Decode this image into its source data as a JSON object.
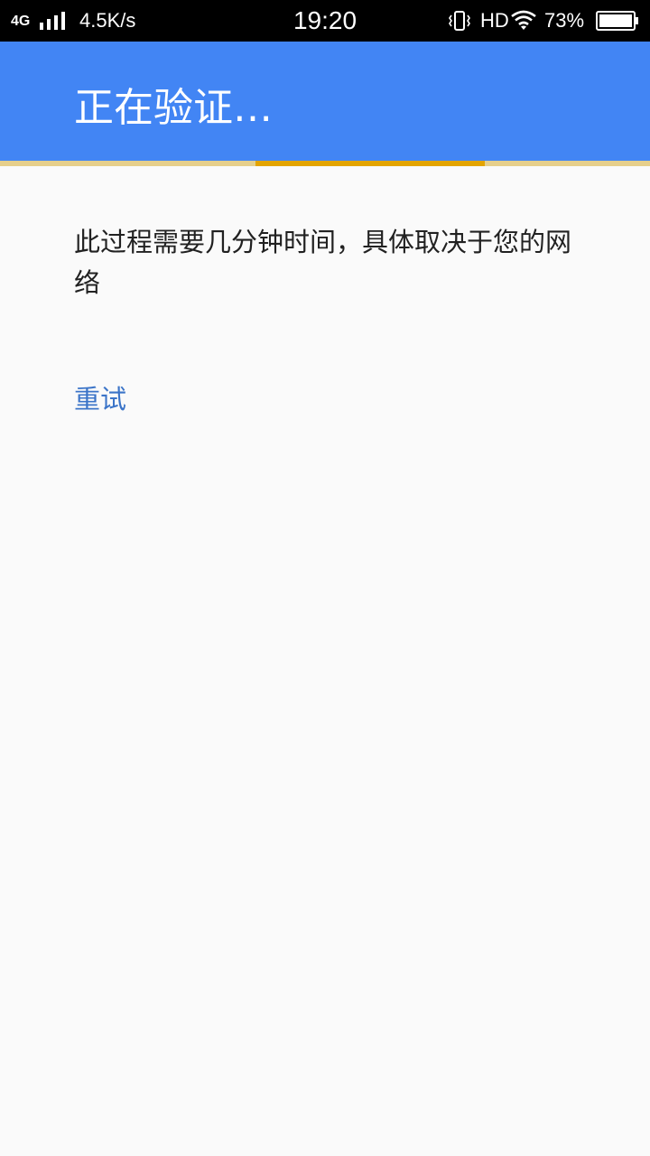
{
  "status_bar": {
    "network": "4G",
    "speed": "4.5K/s",
    "time": "19:20",
    "hd": "HD",
    "battery_percent": "73%",
    "icons": [
      "signal-icon",
      "vibrate-icon",
      "wifi-icon",
      "battery-icon"
    ]
  },
  "appbar": {
    "title": "正在验证…",
    "background": "#4285f4"
  },
  "progress": {
    "track_color": "#e6cf8b",
    "indicator_color": "#e3a400",
    "indeterminate": true
  },
  "content": {
    "message": "此过程需要几分钟时间，具体取决于您的网络",
    "retry_label": "重试",
    "retry_color": "#3b74c8"
  }
}
